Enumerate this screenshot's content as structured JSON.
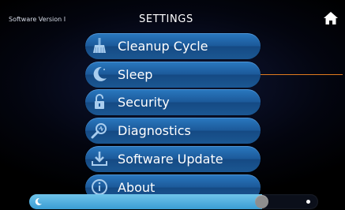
{
  "header": {
    "software_version": "Software Version I",
    "title": "SETTINGS",
    "home_icon": "home-icon"
  },
  "menu": {
    "items": [
      {
        "label": "Cleanup Cycle",
        "icon": "broom-icon"
      },
      {
        "label": "Sleep",
        "icon": "moon-icon"
      },
      {
        "label": "Security",
        "icon": "lock-icon"
      },
      {
        "label": "Diagnostics",
        "icon": "magnifier-icon"
      },
      {
        "label": "Software Update",
        "icon": "download-icon"
      },
      {
        "label": "About",
        "icon": "info-icon"
      }
    ]
  },
  "brightness": {
    "level_percent": 82,
    "min_icon": "moon-icon",
    "max_icon": "sun-icon"
  },
  "colors": {
    "button_blue": "#1c5a9a",
    "slider_fill": "#4aa9dc",
    "connector_orange": "#e07a1e",
    "background": "#000000"
  }
}
